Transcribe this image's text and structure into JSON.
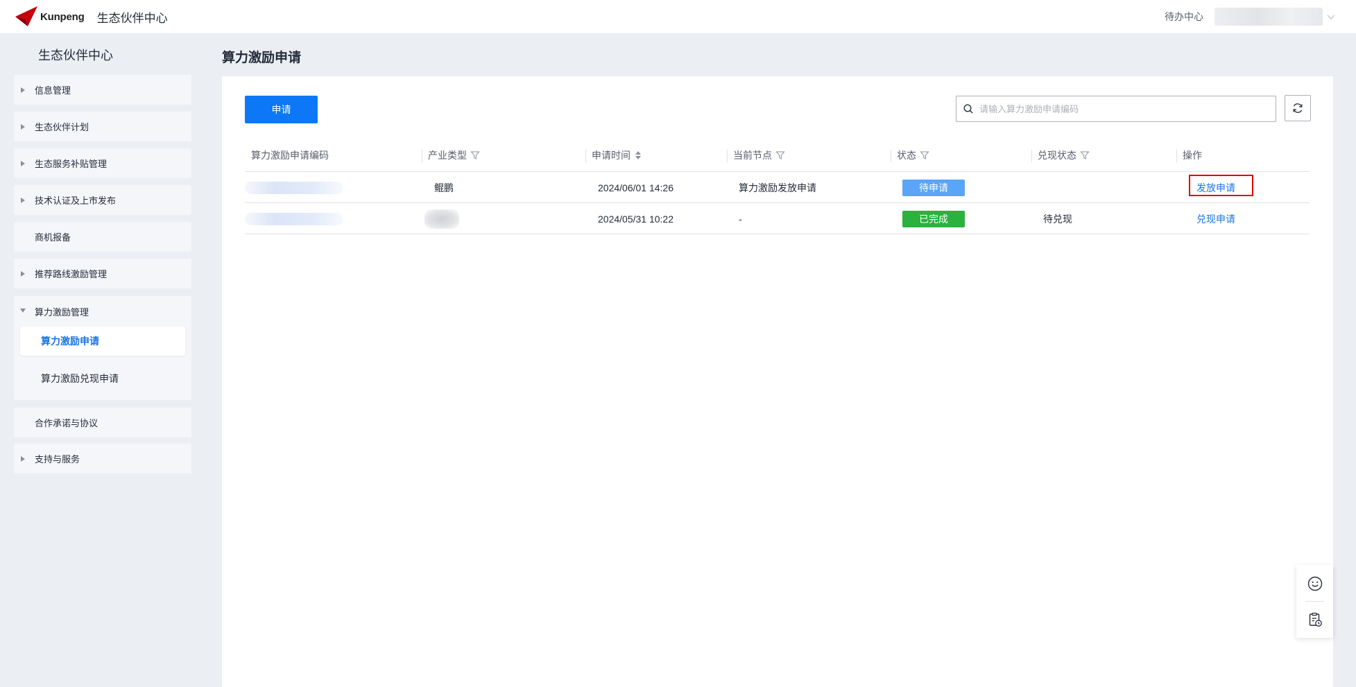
{
  "header": {
    "logo_text": "Kunpeng",
    "title": "生态伙伴中心",
    "todo_label": "待办中心"
  },
  "sidebar": {
    "title": "生态伙伴中心",
    "items": [
      {
        "label": "信息管理",
        "has_arrow": true
      },
      {
        "label": "生态伙伴计划",
        "has_arrow": true
      },
      {
        "label": "生态服务补贴管理",
        "has_arrow": true
      },
      {
        "label": "技术认证及上市发布",
        "has_arrow": true
      },
      {
        "label": "商机报备",
        "has_arrow": false
      },
      {
        "label": "推荐路线激励管理",
        "has_arrow": true
      }
    ],
    "expanded_group": {
      "label": "算力激励管理",
      "children": [
        "算力激励申请",
        "算力激励兑现申请"
      ],
      "active_child": "算力激励申请"
    },
    "items_after": [
      {
        "label": "合作承诺与协议",
        "has_arrow": false
      },
      {
        "label": "支持与服务",
        "has_arrow": true
      }
    ]
  },
  "page": {
    "title": "算力激励申请",
    "apply_button": "申请",
    "search_placeholder": "请输入算力激励申请编码"
  },
  "table": {
    "columns": [
      "算力激励申请编码",
      "产业类型",
      "申请时间",
      "当前节点",
      "状态",
      "兑现状态",
      "操作"
    ],
    "rows": [
      {
        "code": "",
        "industry": "鲲鹏",
        "time": "2024/06/01 14:26",
        "node": "算力激励发放申请",
        "status": "待申请",
        "cash_status": "",
        "action": "发放申请"
      },
      {
        "code": "",
        "industry": "",
        "time": "2024/05/31 10:22",
        "node": "-",
        "status": "已完成",
        "cash_status": "待兑现",
        "action": "兑现申请"
      }
    ]
  },
  "colors": {
    "primary": "#0c78f7",
    "link": "#1a74e8",
    "status_pending": "#5aa5f7",
    "status_done": "#2bb13d",
    "highlight": "#e00000",
    "logo_red": "#c7000b"
  },
  "icons": [
    "kunpeng-logo-icon",
    "chevron-down-icon",
    "search-icon",
    "refresh-icon",
    "filter-icon",
    "sort-icon",
    "smile-icon",
    "clipboard-clock-icon"
  ]
}
